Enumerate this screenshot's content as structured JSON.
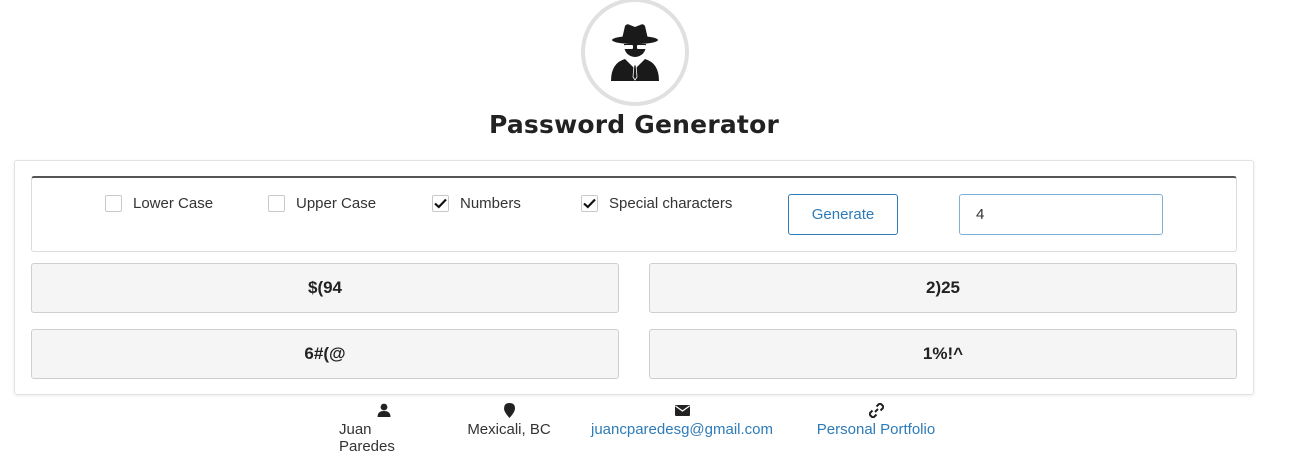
{
  "header": {
    "title": "Password Generator",
    "logo_icon": "spy-icon"
  },
  "options": [
    {
      "label": "Lower Case",
      "checked": false
    },
    {
      "label": "Upper Case",
      "checked": false
    },
    {
      "label": "Numbers",
      "checked": true
    },
    {
      "label": "Special characters",
      "checked": true
    }
  ],
  "generate_button": {
    "label": "Generate"
  },
  "length_input": {
    "value": "4"
  },
  "passwords": [
    "$(94",
    "2)25",
    "6#(@",
    "1%!^"
  ],
  "footer": {
    "name": {
      "icon": "user-icon",
      "text": "Juan Paredes"
    },
    "location": {
      "icon": "map-pin-icon",
      "text": "Mexicali, BC"
    },
    "email": {
      "icon": "envelope-icon",
      "text": "juancparedesg@gmail.com"
    },
    "portfolio": {
      "icon": "link-icon",
      "text": "Personal Portfolio"
    }
  },
  "colors": {
    "accent": "#2d7bb8",
    "panel": "#f5f5f5",
    "border": "#cfcfcf"
  }
}
